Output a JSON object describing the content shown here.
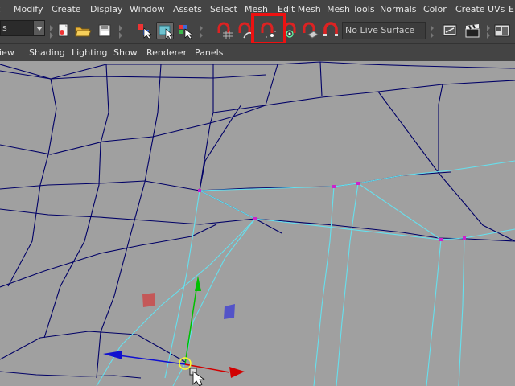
{
  "menubar": {
    "items": [
      "t",
      "Modify",
      "Create",
      "Display",
      "Window",
      "Assets",
      "Select",
      "Mesh",
      "Edit Mesh",
      "Mesh Tools",
      "Normals",
      "Color",
      "Create UVs",
      "E"
    ]
  },
  "toolbar": {
    "mode_select_value": "s",
    "live_surface": "No Live Surface"
  },
  "panel_menu": {
    "items": [
      "iew",
      "Shading",
      "Lighting",
      "Show",
      "Renderer",
      "Panels"
    ]
  },
  "colors": {
    "ui_background": "#444444",
    "viewport_background": "#a0a0a0",
    "wireframe": "#000066",
    "selected_edges": "#66e0ee",
    "vertex": "#cc22cc",
    "highlight_box": "#ee1111",
    "axis_x": "#d10000",
    "axis_y": "#00c000",
    "axis_z": "#1010d0"
  }
}
